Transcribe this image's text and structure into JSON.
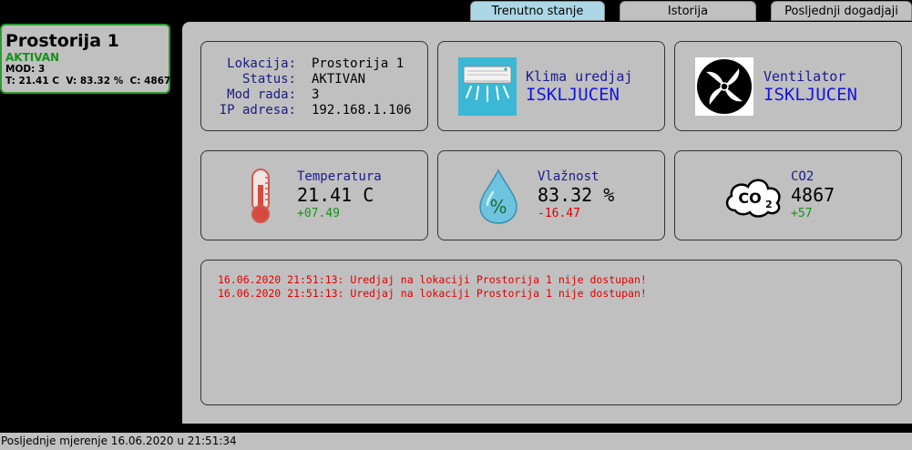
{
  "room": {
    "title": "Prostorija 1",
    "status": "AKTIVAN",
    "mode_line": "MOD: 3",
    "metrics_line": "T: 21.41 C  V: 83.32 %  C: 4867"
  },
  "tabs": [
    {
      "label": "Trenutno stanje",
      "active": true
    },
    {
      "label": "Istorija",
      "active": false
    },
    {
      "label": "Posljednji dogadjaji",
      "active": false
    }
  ],
  "info": {
    "rows": [
      {
        "key": "Lokacija:",
        "value": "Prostorija 1"
      },
      {
        "key": "Status:",
        "value": "AKTIVAN"
      },
      {
        "key": "Mod rada:",
        "value": "3"
      },
      {
        "key": "IP adresa:",
        "value": "192.168.1.106"
      }
    ]
  },
  "devices": {
    "ac": {
      "label": "Klima uredjaj",
      "state": "ISKLJUCEN",
      "icon": "air-conditioner-icon"
    },
    "fan": {
      "label": "Ventilator",
      "state": "ISKLJUCEN",
      "icon": "fan-icon"
    }
  },
  "sensors": {
    "temperature": {
      "label": "Temperatura",
      "value": "21.41 C",
      "delta": "+07.49",
      "delta_color": "#1a8f1a",
      "icon": "thermometer-icon"
    },
    "humidity": {
      "label": "Vlažnost",
      "value": "83.32 %",
      "delta": "-16.47",
      "delta_color": "#e00000",
      "icon": "water-drop-icon"
    },
    "co2": {
      "label": "CO2",
      "value": "4867",
      "delta": "+57",
      "delta_color": "#1a8f1a",
      "icon": "co2-cloud-icon"
    }
  },
  "log": {
    "lines": [
      "16.06.2020 21:51:13: Uredjaj na lokaciji Prostorija 1 nije dostupan!",
      "16.06.2020 21:51:13: Uredjaj na lokaciji Prostorija 1 nije dostupan!"
    ]
  },
  "footer": {
    "text": "Posljednje mjerenje 16.06.2020 u 21:51:34"
  },
  "colors": {
    "active_tab": "#acd8e6",
    "status_green": "#1a8f1a",
    "error_red": "#e00000",
    "state_blue": "#1414e6"
  }
}
